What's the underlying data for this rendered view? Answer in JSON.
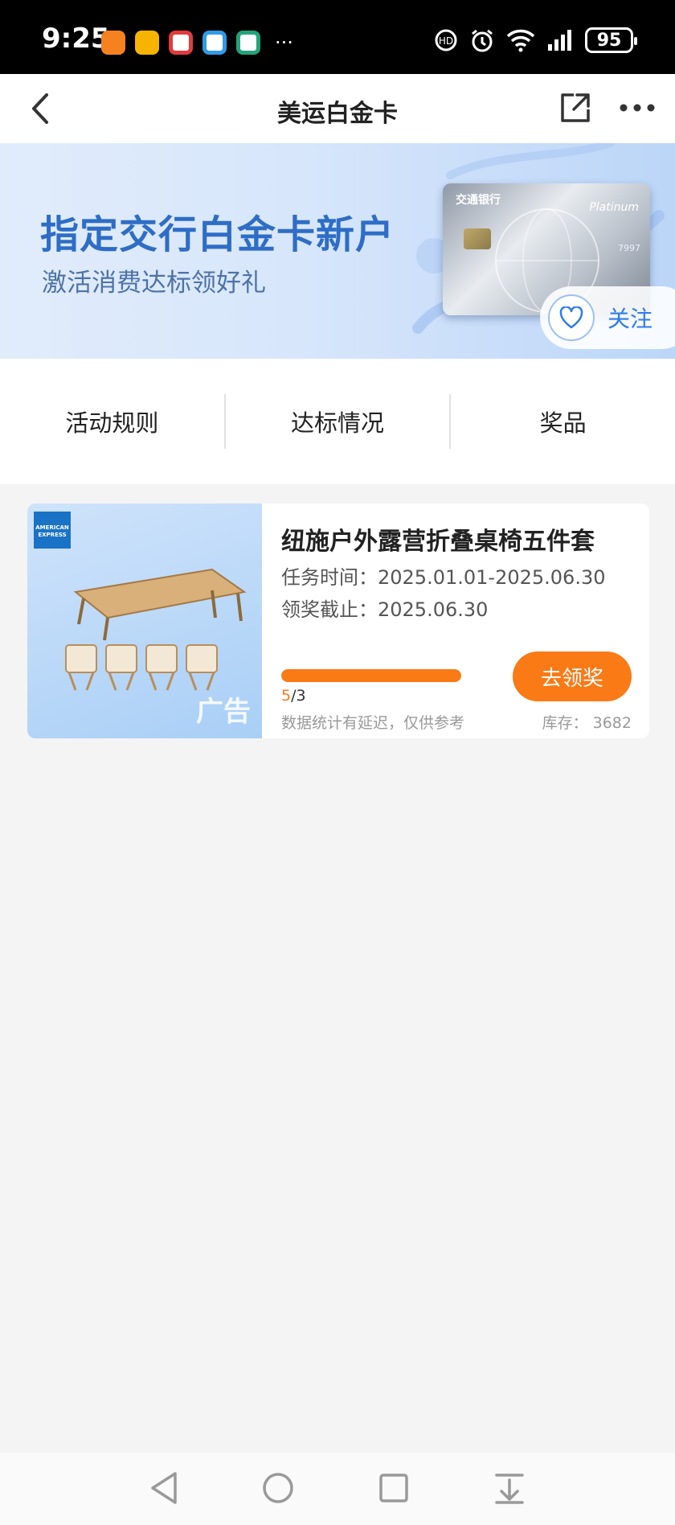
{
  "status_bar": {
    "time": "9:25",
    "battery": "95",
    "app_icons": [
      {
        "icon": "app-icon-orange",
        "color": "#f5821f"
      },
      {
        "icon": "mail-icon",
        "color": "#f6b400"
      },
      {
        "icon": "app-icon-red",
        "color": "#e23b3b"
      },
      {
        "icon": "china-mobile-icon",
        "color": "#2f9be6"
      },
      {
        "icon": "app-icon-green",
        "color": "#22a37a"
      }
    ],
    "more": "···"
  },
  "navbar": {
    "title": "美运白金卡"
  },
  "banner": {
    "headline": "指定交行白金卡新户",
    "subline": "激活消费达标领好礼",
    "card_bank": "交通银行",
    "card_tier": "Platinum",
    "card_number": "7997",
    "follow_label": "关注"
  },
  "tabs": [
    {
      "label": "活动规则"
    },
    {
      "label": "达标情况"
    },
    {
      "label": "奖品"
    }
  ],
  "prize": {
    "title": "纽施户外露营折叠桌椅五件套",
    "task_time": "任务时间：2025.01.01-2025.06.30",
    "claim_deadline": "领奖截止：2025.06.30",
    "progress_current": "5",
    "progress_total": "/3",
    "progress_fraction": 1.0,
    "note": "数据统计有延迟，仅供参考",
    "stock": "库存：  3682",
    "claim_button": "去领奖",
    "ad_tag": "广告",
    "amex_label": "AMERICAN EXPRESS"
  },
  "colors": {
    "accent": "#fa7a16",
    "banner_text": "#2e6dc6",
    "link_blue": "#2f7ce8"
  }
}
